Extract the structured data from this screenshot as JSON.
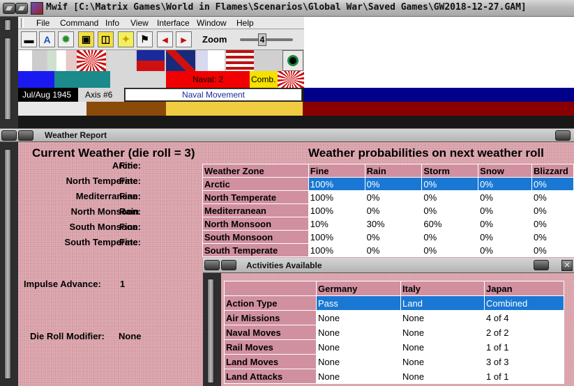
{
  "window": {
    "title": "Mwif [C:\\Matrix Games\\World in Flames\\Scenarios\\Global War\\Saved Games\\GW2018-12-27.GAM]"
  },
  "menu": [
    "File",
    "Command",
    "Info",
    "View",
    "Interface",
    "Window",
    "Help"
  ],
  "toolbar": {
    "buttons": [
      {
        "name": "unit-icon",
        "glyph": "▬"
      },
      {
        "name": "text-a-icon",
        "glyph": "A"
      },
      {
        "name": "gear-icon",
        "glyph": "✹"
      },
      {
        "name": "box-icon",
        "glyph": "▣"
      },
      {
        "name": "box-alt-icon",
        "glyph": "◫"
      },
      {
        "name": "star-icon",
        "glyph": "✦"
      },
      {
        "name": "flag-icon",
        "glyph": "⚑"
      },
      {
        "name": "arrow-left-icon",
        "glyph": "◄"
      },
      {
        "name": "arrow-right-icon",
        "glyph": "►"
      }
    ],
    "zoom_label": "Zoom",
    "zoom_value": "4"
  },
  "status": {
    "naval": "Naval: 2",
    "comb": "Comb.",
    "date": "Jul/Aug 1945",
    "axis": "Axis #6",
    "phase": "Naval Movement"
  },
  "weather": {
    "window_title": "Weather Report",
    "current_title": "Current Weather (die roll = 3)",
    "zones": [
      {
        "label": "Arctic:",
        "value": "Fine"
      },
      {
        "label": "North Temperate:",
        "value": "Fine"
      },
      {
        "label": "Mediterranean:",
        "value": "Fine"
      },
      {
        "label": "North Monsoon:",
        "value": "Rain"
      },
      {
        "label": "South Monsoon:",
        "value": "Fine"
      },
      {
        "label": "South Temperate:",
        "value": "Fine"
      }
    ],
    "impulse_label": "Impulse Advance:",
    "impulse_value": "1",
    "modifier_label": "Die Roll Modifier:",
    "modifier_value": "None",
    "prob_title": "Weather probabilities on next weather roll",
    "prob_headers": [
      "Weather Zone",
      "Fine",
      "Rain",
      "Storm",
      "Snow",
      "Blizzard"
    ],
    "prob_rows": [
      {
        "zone": "Arctic",
        "vals": [
          "100%",
          "0%",
          "0%",
          "0%",
          "0%"
        ]
      },
      {
        "zone": "North Temperate",
        "vals": [
          "100%",
          "0%",
          "0%",
          "0%",
          "0%"
        ]
      },
      {
        "zone": "Mediterranean",
        "vals": [
          "100%",
          "0%",
          "0%",
          "0%",
          "0%"
        ]
      },
      {
        "zone": "North Monsoon",
        "vals": [
          "10%",
          "30%",
          "60%",
          "0%",
          "0%"
        ]
      },
      {
        "zone": "South Monsoon",
        "vals": [
          "100%",
          "0%",
          "0%",
          "0%",
          "0%"
        ]
      },
      {
        "zone": "South Temperate",
        "vals": [
          "100%",
          "0%",
          "0%",
          "0%",
          "0%"
        ]
      }
    ]
  },
  "activities": {
    "title": "Activities Available",
    "close_label": "✕",
    "headers": [
      "",
      "Germany",
      "Italy",
      "Japan"
    ],
    "rows": [
      {
        "label": "Action Type",
        "vals": [
          "Pass",
          "Land",
          "Combined"
        ]
      },
      {
        "label": "Air Missions",
        "vals": [
          "None",
          "None",
          "4 of 4"
        ]
      },
      {
        "label": "Naval Moves",
        "vals": [
          "None",
          "None",
          "2 of 2"
        ]
      },
      {
        "label": "Rail Moves",
        "vals": [
          "None",
          "None",
          "1 of 1"
        ]
      },
      {
        "label": "Land Moves",
        "vals": [
          "None",
          "None",
          "3 of 3"
        ]
      },
      {
        "label": "Land Attacks",
        "vals": [
          "None",
          "None",
          "1 of 1"
        ]
      }
    ]
  },
  "colors": {
    "selection": "#1a78d4",
    "pink_bg": "#d9a0a8",
    "header_pink": "#d090a0",
    "navy": "#00008a"
  }
}
